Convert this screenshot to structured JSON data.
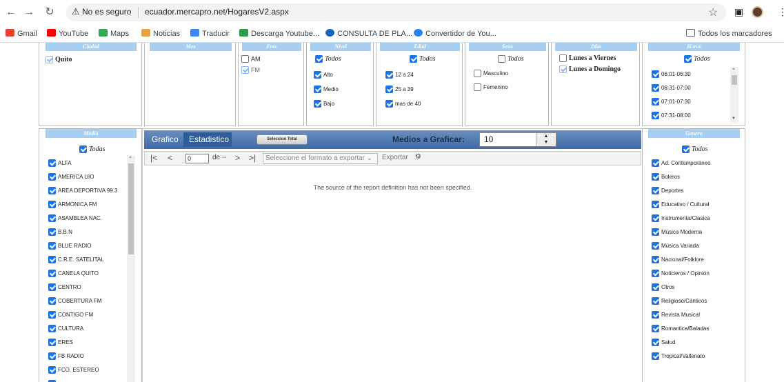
{
  "browser": {
    "security_label": "No es seguro",
    "url": "ecuador.mercapro.net/HogaresV2.aspx",
    "bookmarks": [
      {
        "label": "Gmail",
        "color": "#ea4335"
      },
      {
        "label": "YouTube",
        "color": "#ff0000"
      },
      {
        "label": "Maps",
        "color": "#34a853"
      },
      {
        "label": "Noticias",
        "color": "#e8a33d"
      },
      {
        "label": "Traducir",
        "color": "#4285f4"
      },
      {
        "label": "Descarga Youtube...",
        "color": "#2e9e4a"
      },
      {
        "label": "CONSULTA DE PLA...",
        "color": "#1565c0"
      },
      {
        "label": "Convertidor de You...",
        "color": "#2f80ed"
      }
    ],
    "all_bookmarks": "Todos los marcadores"
  },
  "filters": {
    "ciudad": {
      "title": "Ciudad",
      "items": [
        {
          "label": "Quito",
          "state": "gray"
        }
      ]
    },
    "mes": {
      "title": "Mes"
    },
    "frec": {
      "title": "Frec",
      "items": [
        {
          "label": "AM",
          "state": "off"
        },
        {
          "label": "FM",
          "state": "gray"
        }
      ]
    },
    "nivel": {
      "title": "Nivel",
      "todos": "Todos",
      "items": [
        {
          "label": "Alto"
        },
        {
          "label": "Medio"
        },
        {
          "label": "Bajo"
        }
      ]
    },
    "edad": {
      "title": "Edad",
      "todos": "Todos",
      "items": [
        {
          "label": "12 a 24"
        },
        {
          "label": "25 a 39"
        },
        {
          "label": "mas de 40"
        }
      ]
    },
    "sexo": {
      "title": "Sexo",
      "todos": "Todos",
      "items": [
        {
          "label": "Masculino"
        },
        {
          "label": "Femenino"
        }
      ]
    },
    "dias": {
      "title": "Días",
      "items": [
        {
          "label": "Lunes a Viernes",
          "state": "off"
        },
        {
          "label": "Lunes a Domingo",
          "state": "gray"
        }
      ]
    },
    "horas": {
      "title": "Horas",
      "todos": "Todos",
      "items": [
        {
          "label": "06:01-06:30"
        },
        {
          "label": "06:31-07:00"
        },
        {
          "label": "07:01-07:30"
        },
        {
          "label": "07:31-08:00"
        }
      ]
    }
  },
  "medio": {
    "title": "Medio",
    "todos": "Todas",
    "items": [
      "ALFA",
      "AMERICA UIO",
      "AREA DEPORTIVA 99.3",
      "ARMONICA FM",
      "ASAMBLEA NAC.",
      "B.B.N",
      "BLUE RADIO",
      "C.R.E. SATELITAL",
      "CANELA QUITO",
      "CENTRO",
      "COBERTURA FM",
      "CONTIGO FM",
      "CULTURA",
      "ERES",
      "FB RADIO",
      "FCO. ESTEREO"
    ]
  },
  "genero": {
    "title": "Genero",
    "todos": "Todos",
    "items": [
      "Ad. Contemporáneo",
      "Boleros",
      "Deportes",
      "Educativo / Cultural",
      "Instrumenta/Clasica",
      "Música Moderna",
      "Música Variada",
      "Nacional/Folklore",
      "Noticieros / Opinión",
      "Otros",
      "Religioso/Cánticos",
      "Revista Musical",
      "Romantica/Baladas",
      "Salud",
      "Tropical/Vallenato"
    ]
  },
  "report": {
    "tab_grafico": "Grafico",
    "tab_estadistico": "Estadistico",
    "select_all": "Seleccion Total",
    "medias_label": "Medios a Graficar:",
    "medias_value": "10",
    "page_value": "0",
    "page_of": "de --",
    "format_placeholder": "Seleccione el formato a exportar",
    "export_label": "Exportar",
    "message": "The source of the report definition has not been specified."
  }
}
